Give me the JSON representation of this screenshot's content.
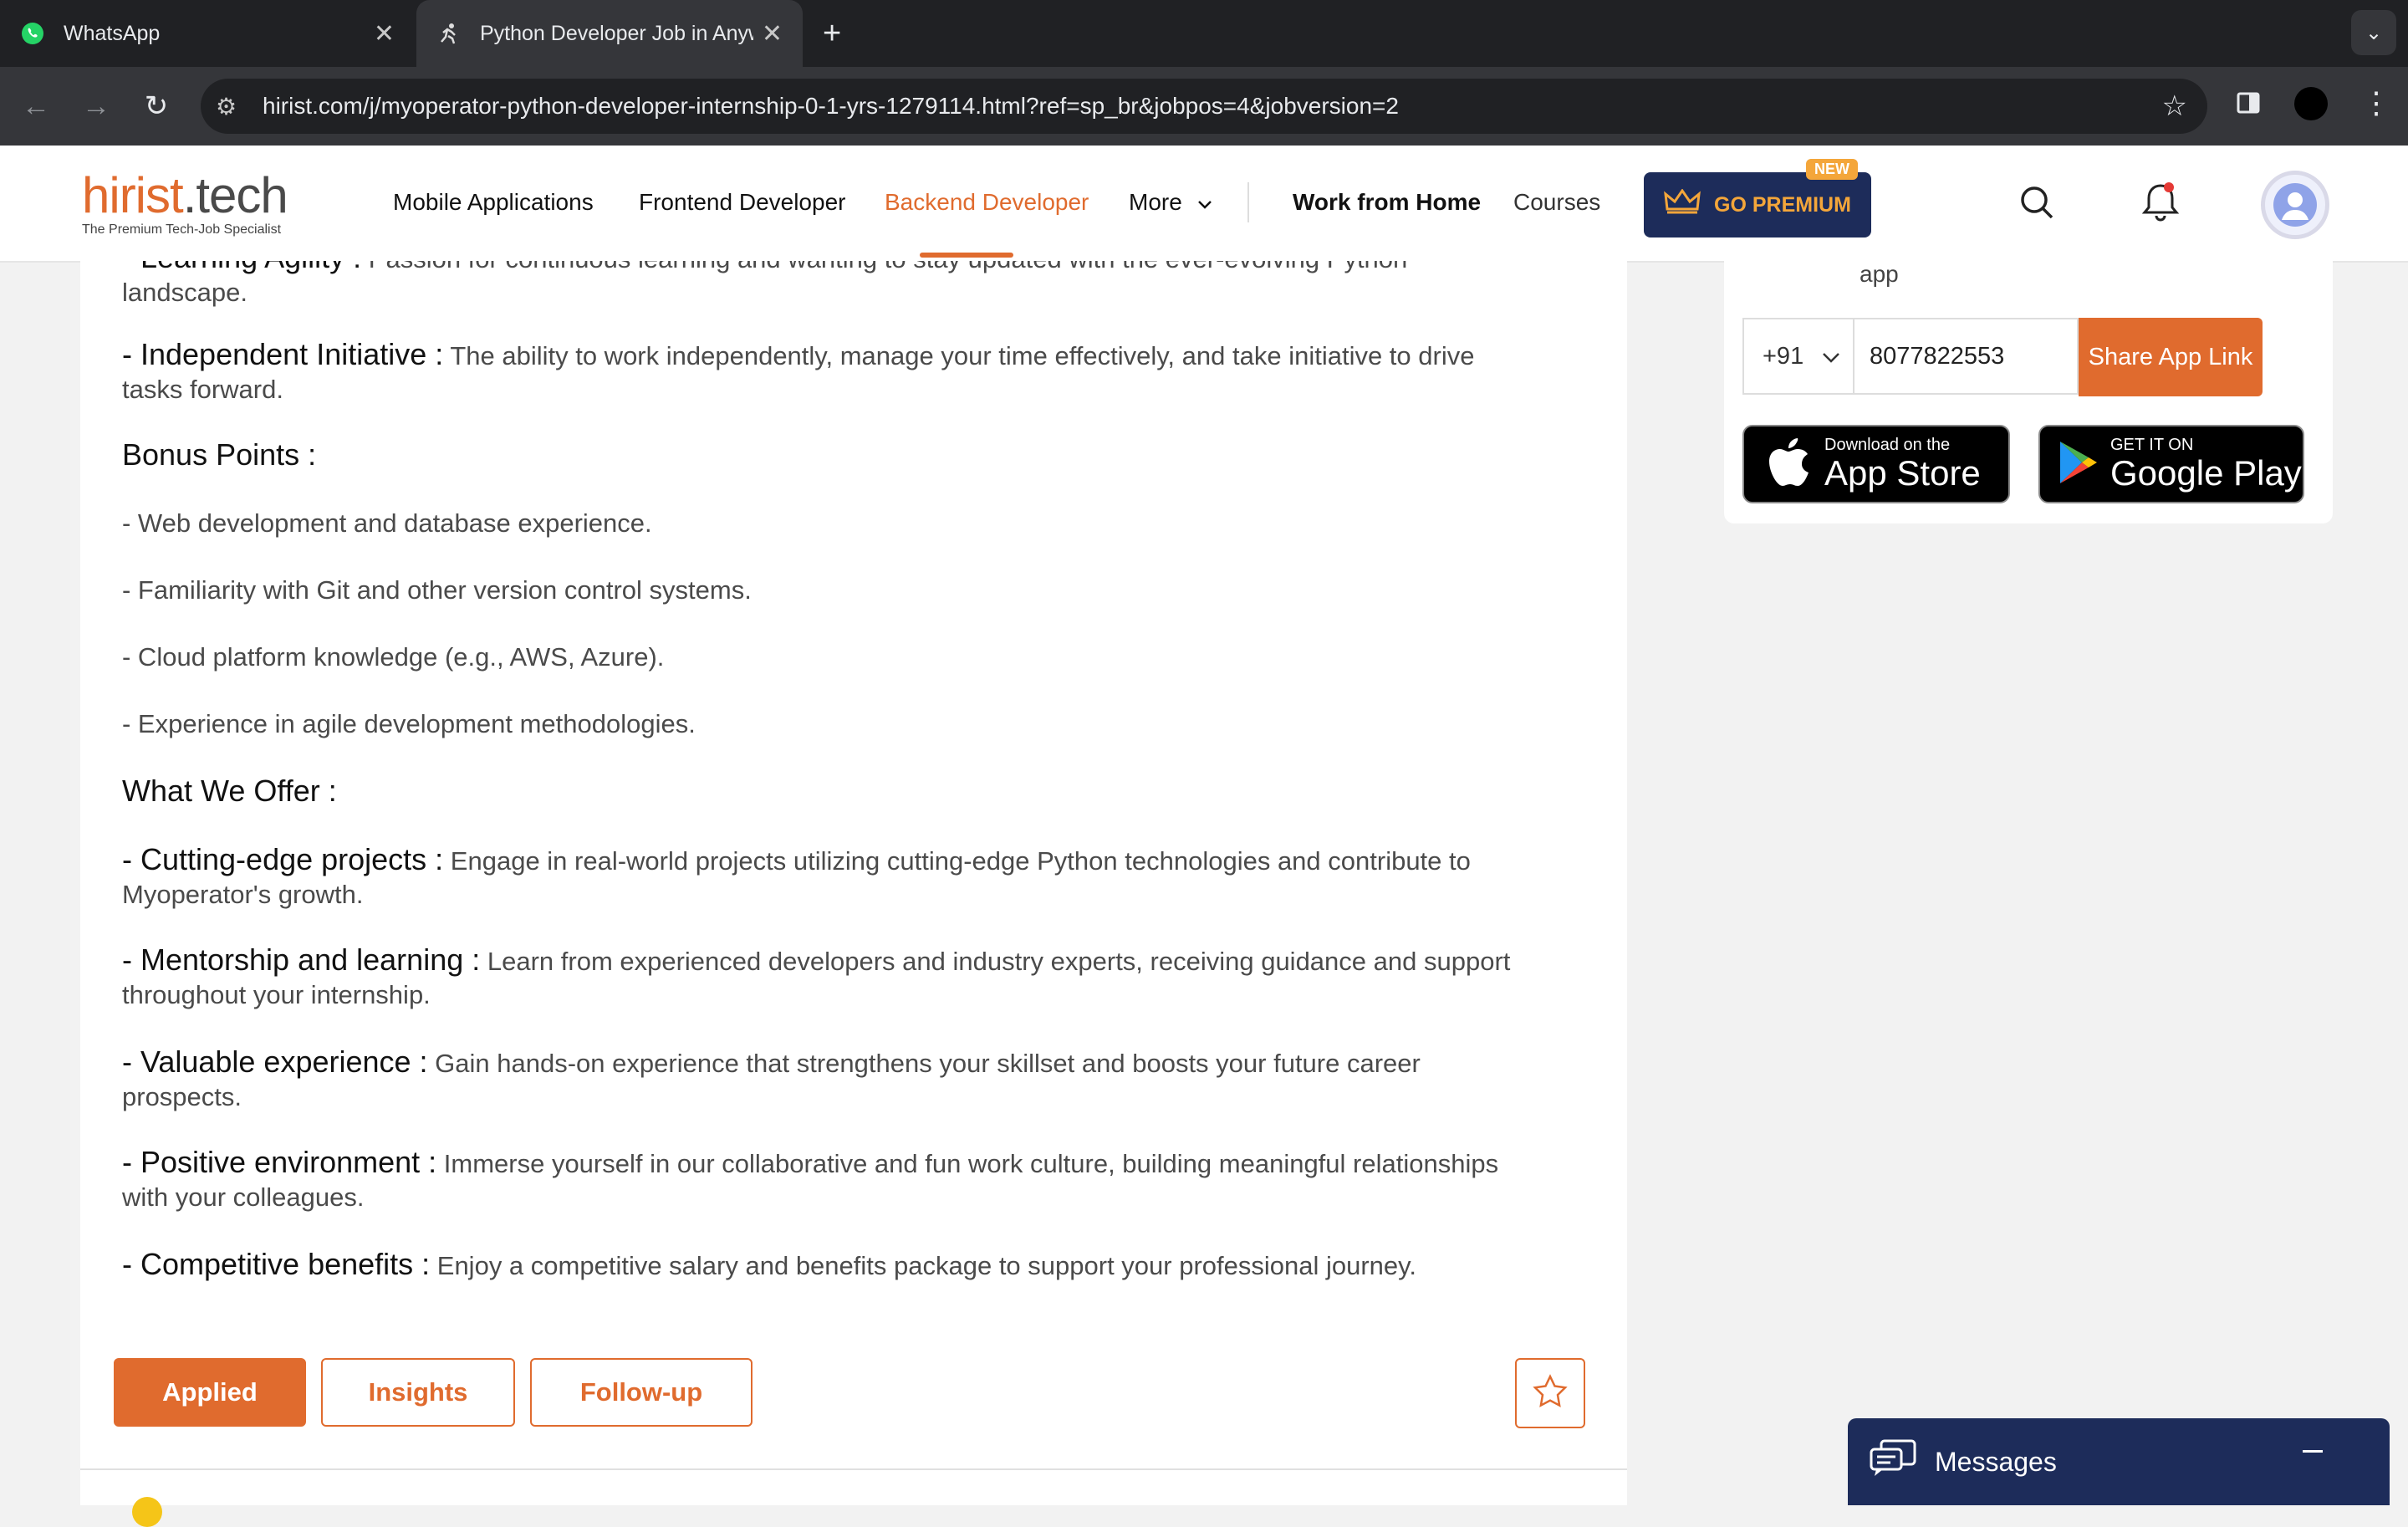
{
  "browser": {
    "tabs": [
      {
        "title": "WhatsApp",
        "active": false
      },
      {
        "title": "Python Developer Job in Anyw",
        "active": true
      }
    ],
    "url": "hirist.com/j/myoperator-python-developer-internship-0-1-yrs-1279114.html?ref=sp_br&jobpos=4&jobversion=2"
  },
  "header": {
    "logo_main": "hirist",
    "logo_dot": ".",
    "logo_tech": "tech",
    "logo_tagline": "The Premium Tech-Job Specialist",
    "nav": [
      {
        "label": "Mobile Applications"
      },
      {
        "label": "Frontend Developer"
      },
      {
        "label": "Backend Developer",
        "active": true
      },
      {
        "label": "More"
      },
      {
        "label": "Work from Home"
      },
      {
        "label": "Courses"
      }
    ],
    "premium_label": "GO PREMIUM",
    "premium_badge": "NEW",
    "accent_color": "#e06b2e",
    "premium_bg": "#1d2c5a"
  },
  "job": {
    "partial_top": {
      "label": "- Learning Agility :",
      "text": "Passion for continuous learning and wanting to stay updated with the ever-evolving Python",
      "cont": "landscape."
    },
    "independent": {
      "label": "- Independent Initiative :",
      "text": " The ability to work independently, manage your time effectively, and take initiative to drive",
      "cont": "tasks forward."
    },
    "bonus_heading": "Bonus Points :",
    "bonus_points": [
      "- Web development and database experience.",
      "- Familiarity with Git and other version control systems.",
      "- Cloud platform knowledge (e.g., AWS, Azure).",
      "- Experience in agile development methodologies."
    ],
    "offer_heading": "What We Offer :",
    "offers": [
      {
        "label": "- Cutting-edge projects :",
        "text": " Engage in real-world projects utilizing cutting-edge Python technologies and contribute to",
        "cont": "Myoperator's growth."
      },
      {
        "label": "- Mentorship and learning :",
        "text": " Learn from experienced developers and industry experts, receiving guidance and support",
        "cont": "throughout your internship."
      },
      {
        "label": "- Valuable experience :",
        "text": " Gain hands-on experience that strengthens your skillset and boosts your future career",
        "cont": "prospects."
      },
      {
        "label": "- Positive environment :",
        "text": " Immerse yourself in our collaborative and fun work culture, building meaningful relationships",
        "cont": "with your colleagues."
      },
      {
        "label": "- Competitive benefits :",
        "text": " Enjoy a competitive salary and benefits package to support your professional journey.",
        "cont": ""
      }
    ],
    "buttons": {
      "applied": "Applied",
      "insights": "Insights",
      "followup": "Follow-up"
    }
  },
  "sidebar": {
    "app_text": "app",
    "country_code": "+91",
    "phone": "8077822553",
    "share_label": "Share App Link",
    "appstore_small": "Download on the",
    "appstore_big": "App Store",
    "googleplay_small": "GET IT ON",
    "googleplay_big": "Google Play"
  },
  "messages": {
    "label": "Messages"
  }
}
